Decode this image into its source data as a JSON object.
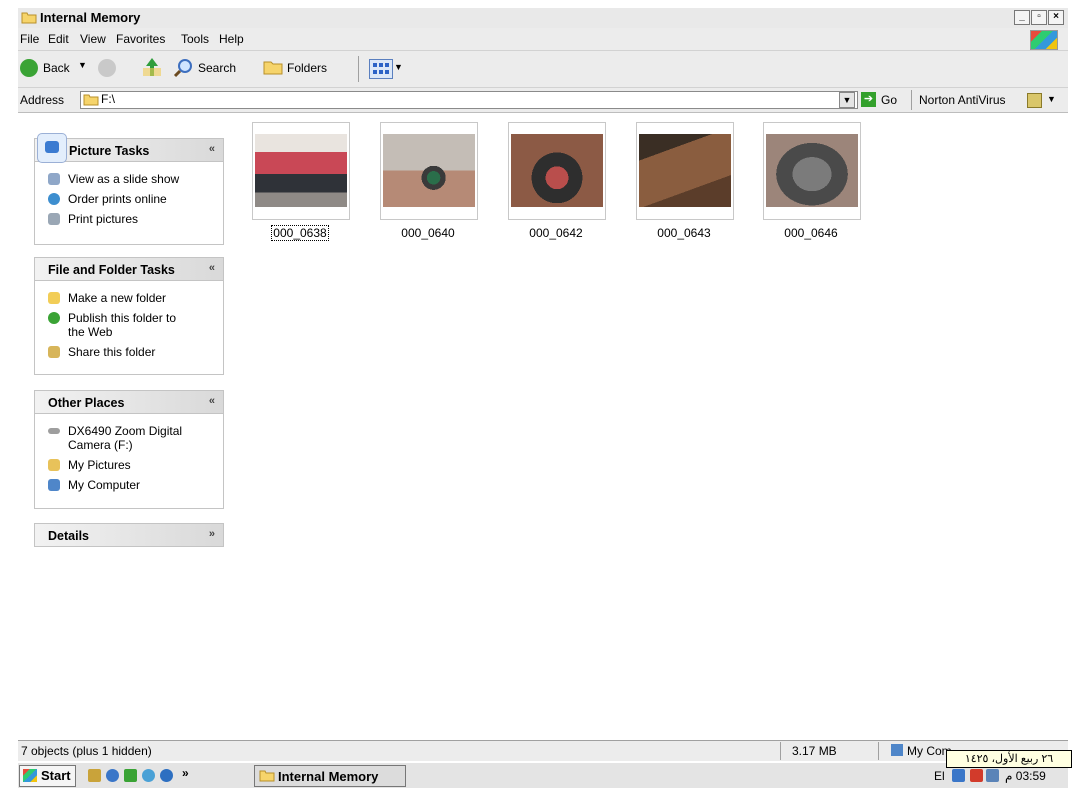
{
  "window": {
    "title": "Internal Memory"
  },
  "menu": [
    "File",
    "Edit",
    "View",
    "Favorites",
    "Tools",
    "Help"
  ],
  "toolbar": {
    "back": "Back",
    "search": "Search",
    "folders": "Folders"
  },
  "address": {
    "label": "Address",
    "value": "F:\\",
    "go": "Go",
    "norton": "Norton AntiVirus"
  },
  "panels": {
    "picture_tasks": {
      "title": "Picture Tasks",
      "items": [
        "View as a slide show",
        "Order prints online",
        "Print pictures"
      ]
    },
    "file_folder_tasks": {
      "title": "File and Folder Tasks",
      "items": [
        "Make a new folder",
        "Publish this folder to",
        "the Web",
        "Share this folder"
      ]
    },
    "other_places": {
      "title": "Other Places",
      "items": [
        "DX6490 Zoom Digital",
        "Camera (F:)",
        "My Pictures",
        "My Computer"
      ]
    },
    "details": {
      "title": "Details"
    }
  },
  "files": [
    {
      "name": "000_0638",
      "selected": true
    },
    {
      "name": "000_0640"
    },
    {
      "name": "000_0642"
    },
    {
      "name": "000_0643"
    },
    {
      "name": "000_0646"
    }
  ],
  "statusbar": {
    "objects": "7 objects (plus 1 hidden)",
    "size": "3.17 MB",
    "zone": "My Com"
  },
  "taskbar": {
    "start": "Start",
    "task": "Internal Memory",
    "chevron": "»",
    "lang": "El",
    "time": "03:59 م",
    "tooltip": "٢٦ ربيع الأول، ١٤٢٥"
  }
}
